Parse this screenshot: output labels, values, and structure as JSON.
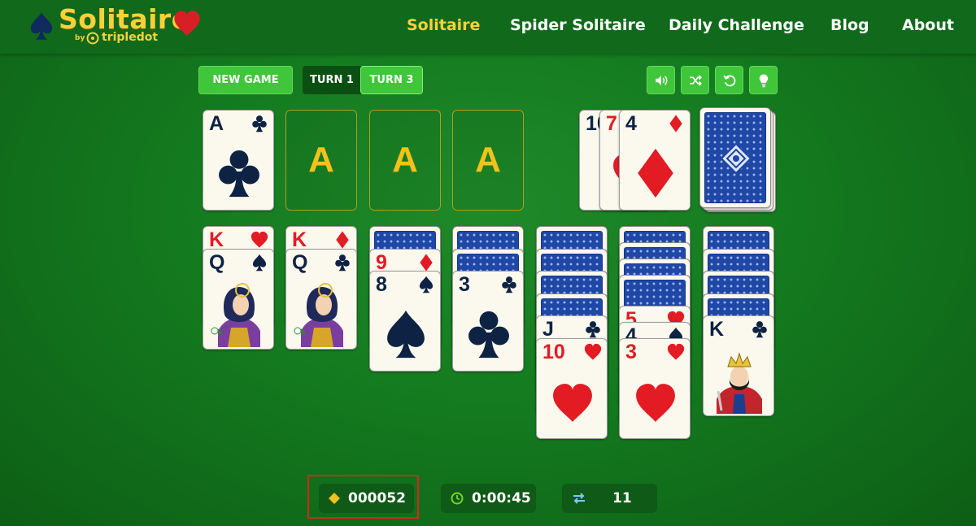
{
  "header": {
    "logo_title": "Solitaire",
    "logo_by": "by",
    "logo_brand": "tripledot",
    "nav": [
      "Solitaire",
      "Spider Solitaire",
      "Daily Challenge",
      "Blog",
      "About"
    ],
    "active_nav": "Solitaire"
  },
  "toolbar": {
    "new_game": "NEW GAME",
    "turn1": "TURN 1",
    "turn3": "TURN 3",
    "selected_turn": "TURN 3",
    "icons": [
      "sound-icon",
      "shuffle-icon",
      "undo-icon",
      "hint-icon"
    ]
  },
  "foundations": [
    {
      "top": "A♣",
      "rank": "A",
      "suit": "clubs"
    },
    {
      "placeholder": "A"
    },
    {
      "placeholder": "A"
    },
    {
      "placeholder": "A"
    }
  ],
  "waste": {
    "cards": [
      {
        "rank": "10",
        "suit": "hearts"
      },
      {
        "rank": "7",
        "suit": "hearts"
      },
      {
        "rank": "4",
        "suit": "diamonds"
      }
    ],
    "partial_rank_1": "1(",
    "partial_rank_2": "7",
    "top_rank": "4"
  },
  "stock": {
    "card": "face-down"
  },
  "tableau": [
    {
      "face_down": 0,
      "face_up": [
        {
          "rank": "K",
          "suit": "hearts"
        },
        {
          "rank": "Q",
          "suit": "spades"
        }
      ]
    },
    {
      "face_down": 0,
      "face_up": [
        {
          "rank": "K",
          "suit": "diamonds"
        },
        {
          "rank": "Q",
          "suit": "clubs"
        }
      ]
    },
    {
      "face_down": 1,
      "face_up": [
        {
          "rank": "9",
          "suit": "diamonds"
        },
        {
          "rank": "8",
          "suit": "spades"
        }
      ]
    },
    {
      "face_down": 2,
      "face_up": [
        {
          "rank": "3",
          "suit": "clubs"
        }
      ]
    },
    {
      "face_down": 4,
      "face_up": [
        {
          "rank": "J",
          "suit": "clubs"
        },
        {
          "rank": "10",
          "suit": "hearts"
        }
      ]
    },
    {
      "face_down": 4,
      "face_up": [
        {
          "rank": "5",
          "suit": "hearts"
        },
        {
          "rank": "4",
          "suit": "spades"
        },
        {
          "rank": "3",
          "suit": "hearts"
        }
      ]
    },
    {
      "face_down": 4,
      "face_up": [
        {
          "rank": "K",
          "suit": "clubs"
        }
      ]
    }
  ],
  "labels": {
    "t0a": "K",
    "t0b": "Q",
    "t1a": "K",
    "t1b": "Q",
    "t2a": "9",
    "t2b": "8",
    "t3a": "3",
    "t4a": "J",
    "t4b": "10",
    "t5a": "5",
    "t5b": "4",
    "t5c": "3",
    "t6a": "K",
    "f0": "A",
    "f1": "A",
    "f2": "A",
    "f3": "A"
  },
  "stats": {
    "score": "000052",
    "time": "0:00:45",
    "moves": "11"
  },
  "colors": {
    "felt": "#147a1f",
    "header": "#11691b",
    "accent": "#f4d33a",
    "button": "#3fc63a",
    "red_suit": "#e31b23",
    "black_suit": "#0e2344",
    "highlight": "#d9241c"
  }
}
